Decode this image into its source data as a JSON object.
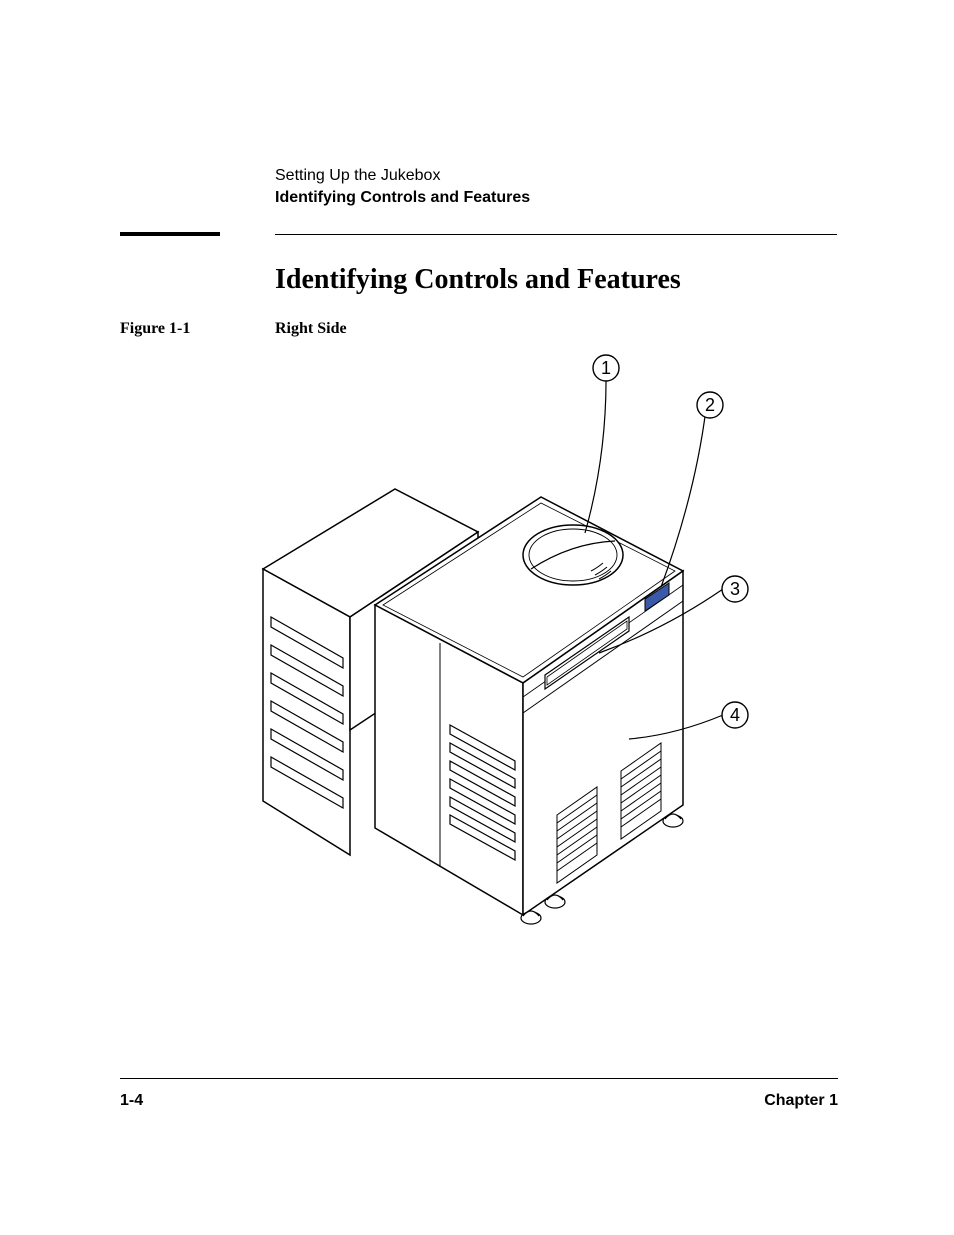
{
  "header": {
    "line1": "Setting Up the Jukebox",
    "line2": "Identifying Controls and Features"
  },
  "section": {
    "heading": "Identifying Controls and Features"
  },
  "figure": {
    "label": "Figure 1-1",
    "caption": "Right Side",
    "callouts": [
      "1",
      "2",
      "3",
      "4"
    ]
  },
  "footer": {
    "page": "1-4",
    "chapter": "Chapter 1"
  }
}
